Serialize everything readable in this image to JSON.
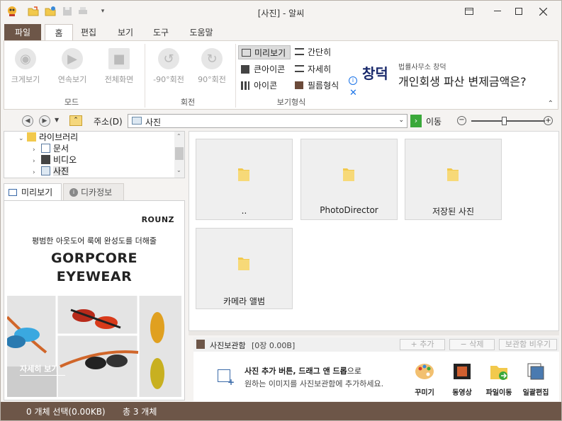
{
  "window": {
    "title": "[사진] - 알씨"
  },
  "menu": {
    "file": "파일",
    "tabs": [
      "홈",
      "편집",
      "보기",
      "도구",
      "도움말"
    ]
  },
  "ribbon": {
    "mode_buttons": [
      "크게보기",
      "연속보기",
      "전체화면"
    ],
    "mode_group": "모드",
    "rotate_buttons": [
      "-90°회전",
      "90°회전"
    ],
    "rotate_group": "회전",
    "view_options": [
      "미리보기",
      "간단히",
      "큰아이콘",
      "자세히",
      "아이콘",
      "필름형식"
    ],
    "view_group": "보기형식"
  },
  "ad": {
    "sub": "법률사무소 창덕",
    "headline": "개인회생 파산 변제금액은?",
    "logo": "창덕"
  },
  "address": {
    "label": "주소(D)",
    "value": "사진",
    "go": "이동"
  },
  "tree": {
    "root": "라이브러리",
    "items": [
      "문서",
      "비디오",
      "사진"
    ]
  },
  "preview_tabs": {
    "preview": "미리보기",
    "exif": "디카정보"
  },
  "banner": {
    "brand": "ROUNZ",
    "tagline": "평범한 아웃도어 룩에 완성도를 더해줄",
    "title1": "GORPCORE",
    "title2": "EYEWEAR",
    "cta": "자세히 보기"
  },
  "files": [
    "..",
    "PhotoDirector",
    "저장된 사진",
    "카메라 앨범"
  ],
  "storage": {
    "title": "사진보관함",
    "count": "[0장 0.00B]",
    "add": "+ 추가",
    "remove": "− 삭제",
    "clear": "보관함 비우기",
    "hint_bold": "사진 추가 버튼, 드래그 앤 드롭",
    "hint_tail": "으로",
    "hint_line2": "원하는 이미지를 사진보관함에 추가하세요.",
    "tools": [
      "꾸미기",
      "동영상",
      "파일이동",
      "일괄편집"
    ]
  },
  "status": {
    "selection": "0 개체 선택(0.00KB)",
    "total": "총 3 개체"
  },
  "colors": {
    "brand_brown": "#6d5648",
    "folder_yellow": "#f2c94c",
    "go_green": "#3aa83a"
  }
}
